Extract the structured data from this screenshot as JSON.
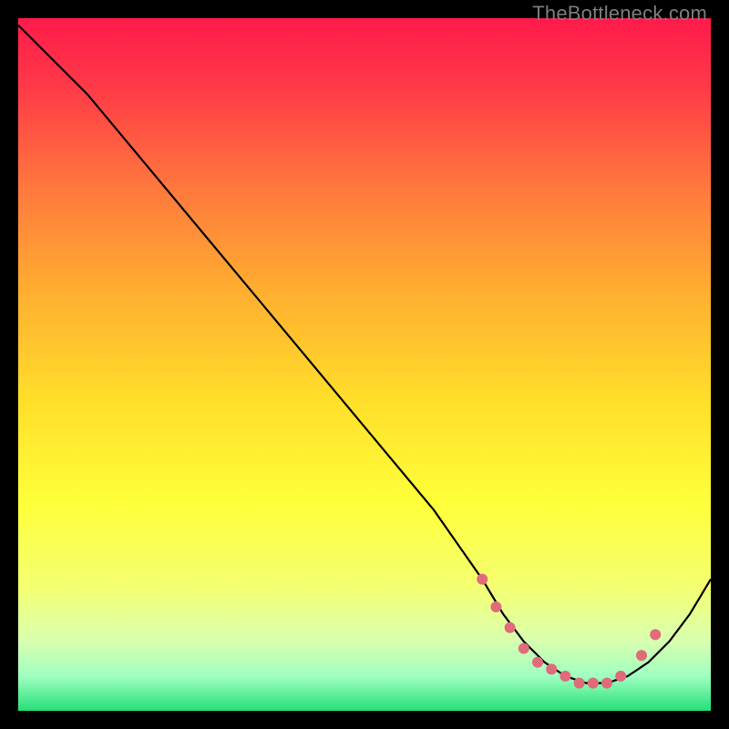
{
  "watermark": "TheBottleneck.com",
  "chart_data": {
    "type": "line",
    "title": "",
    "xlabel": "",
    "ylabel": "",
    "xlim": [
      0,
      100
    ],
    "ylim": [
      0,
      100
    ],
    "grid": false,
    "legend": false,
    "background_gradient": {
      "stops": [
        {
          "offset": 0.0,
          "color": "#ff1a4b"
        },
        {
          "offset": 0.1,
          "color": "#ff3a47"
        },
        {
          "offset": 0.25,
          "color": "#ff7a3d"
        },
        {
          "offset": 0.4,
          "color": "#ffb030"
        },
        {
          "offset": 0.55,
          "color": "#ffde2a"
        },
        {
          "offset": 0.7,
          "color": "#ffff3a"
        },
        {
          "offset": 0.82,
          "color": "#f4ff70"
        },
        {
          "offset": 0.9,
          "color": "#d8ffb0"
        },
        {
          "offset": 0.95,
          "color": "#9fffc0"
        },
        {
          "offset": 1.0,
          "color": "#24e07a"
        }
      ]
    },
    "series": [
      {
        "name": "bottleneck-curve",
        "color": "#000000",
        "x": [
          0,
          5,
          10,
          20,
          30,
          40,
          50,
          60,
          67,
          70,
          73,
          76,
          79,
          82,
          85,
          88,
          91,
          94,
          97,
          100
        ],
        "y": [
          99,
          94,
          89,
          77,
          65,
          53,
          41,
          29,
          19,
          14,
          10,
          7,
          5,
          4,
          4,
          5,
          7,
          10,
          14,
          19
        ]
      }
    ],
    "markers": {
      "name": "highlight-points",
      "color": "#e06b7a",
      "x": [
        67,
        69,
        71,
        73,
        75,
        77,
        79,
        81,
        83,
        85,
        87,
        90,
        92
      ],
      "y": [
        19,
        15,
        12,
        9,
        7,
        6,
        5,
        4,
        4,
        4,
        5,
        8,
        11
      ]
    }
  }
}
